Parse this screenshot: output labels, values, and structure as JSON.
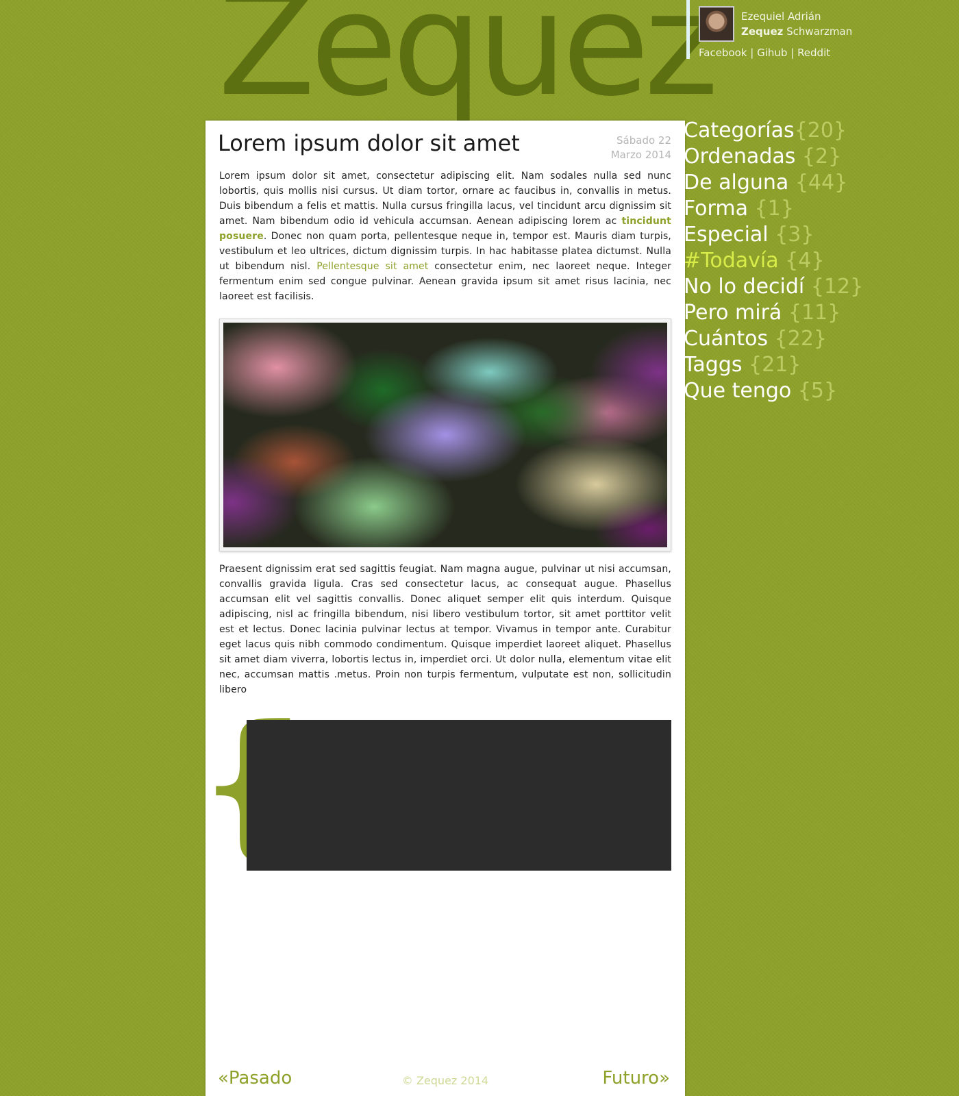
{
  "site": {
    "brand": "Zequez"
  },
  "profile": {
    "first_names": "Ezequiel Adrián",
    "nick": "Zequez",
    "surname": "Schwarzman",
    "links": [
      "Facebook",
      "Gihub",
      "Reddit"
    ],
    "separator": "|"
  },
  "post": {
    "title": "Lorem ipsum dolor sit amet",
    "date_line1": "Sábado 22",
    "date_line2": "Marzo 2014",
    "p1_a": "Lorem ipsum dolor sit amet, consectetur adipiscing elit. Nam sodales nulla sed nunc lobortis, quis mollis nisi cursus. Ut diam tortor, ornare ac faucibus in, convallis in metus. Duis bibendum a felis et mattis. Nulla cursus fringilla lacus, vel tincidunt arcu dignissim sit amet. Nam bibendum odio id vehicula accumsan. Aenean adipiscing lorem ac ",
    "p1_link1": "tincidunt posuere",
    "p1_b": ". Donec non quam porta, pellentesque neque in, tempor est. Mauris diam turpis, vestibulum et leo ultrices, dictum dignissim turpis. In hac habitasse platea dictumst. Nulla ut bibendum nisl. ",
    "p1_link2": "Pellentesque sit amet",
    "p1_c": " consectetur enim, nec laoreet neque. Integer fermentum enim sed congue pulvinar. Aenean gravida ipsum sit amet risus lacinia, nec laoreet est facilisis.",
    "p2": "Praesent dignissim erat sed sagittis feugiat. Nam magna augue, pulvinar ut nisi accumsan, convallis gravida ligula. Cras sed consectetur lacus, ac consequat augue. Phasellus accumsan elit vel sagittis convallis. Donec aliquet semper elit quis interdum. Quisque adipiscing, nisl ac fringilla bibendum, nisi libero vestibulum tortor, sit amet porttitor velit est et lectus. Donec lacinia pulvinar lectus at tempor. Vivamus in tempor ante. Curabitur eget lacus quis nibh commodo condimentum. Quisque imperdiet laoreet aliquet. Phasellus sit amet diam viverra, lobortis lectus in, imperdiet orci. Ut dolor nulla, elementum vitae elit nec, accumsan mattis .metus. Proin non turpis fermentum, vulputate est non, sollicitudin libero",
    "brace": "{"
  },
  "footer": {
    "prev": "«Pasado",
    "next": "Futuro»",
    "copyright": "© Zequez 2014"
  },
  "categories": [
    {
      "label": "Categorías",
      "count": "{20}"
    },
    {
      "label": "Ordenadas",
      "count": "{2}"
    },
    {
      "label": "De alguna",
      "count": "{44}"
    },
    {
      "label": "Forma",
      "count": "{1}"
    },
    {
      "label": "Especial",
      "count": "{3}"
    },
    {
      "label": "#Todavía",
      "count": "{4}"
    },
    {
      "label": "No lo decidí",
      "count": "{12}"
    },
    {
      "label": "Pero mirá",
      "count": "{11}"
    },
    {
      "label": "Cuántos",
      "count": "{22}"
    },
    {
      "label": "Taggs",
      "count": "{21}"
    },
    {
      "label": "Que tengo",
      "count": "{5}"
    }
  ],
  "colors": {
    "background": "#8ea12a",
    "brand_text": "#5b6e10",
    "accent": "#8ea12a",
    "active_category": "#d8ec4a",
    "code_block": "#2c2c2c"
  }
}
